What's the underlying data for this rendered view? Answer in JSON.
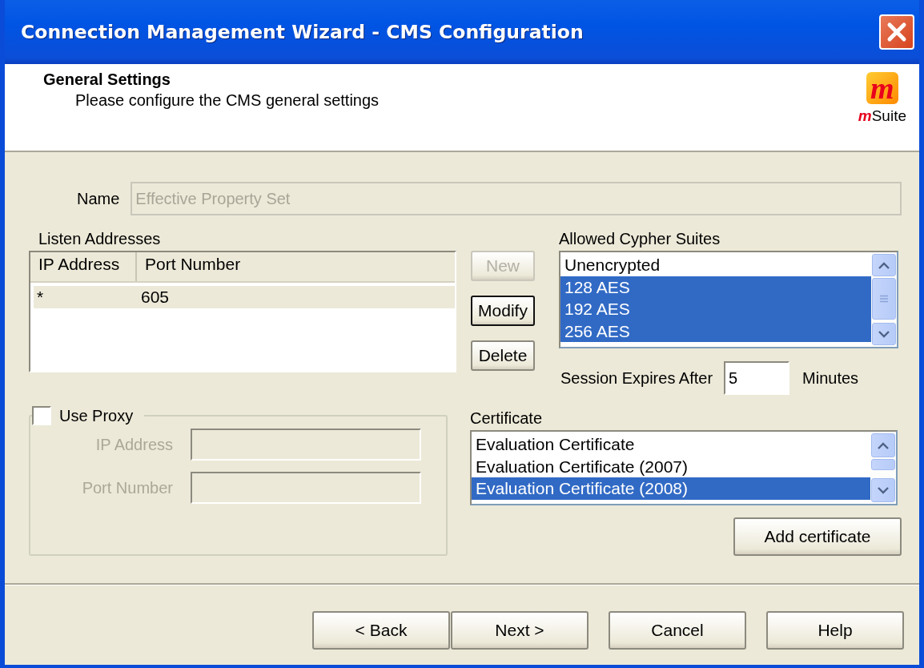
{
  "window": {
    "title": "Connection Management Wizard - CMS Configuration"
  },
  "header": {
    "title": "General Settings",
    "subtitle": "Please configure the CMS general settings",
    "logo": {
      "mark": "m",
      "wordmark_prefix": "m",
      "wordmark": "Suite"
    }
  },
  "name_field": {
    "label": "Name",
    "value": "Effective Property Set",
    "disabled": true
  },
  "listen_addresses": {
    "label": "Listen Addresses",
    "columns": [
      "IP Address",
      "Port Number"
    ],
    "rows": [
      {
        "cells": [
          "*",
          "605"
        ],
        "selected": true
      }
    ]
  },
  "address_buttons": [
    {
      "label": "New",
      "disabled": true,
      "focused": false
    },
    {
      "label": "Modify",
      "disabled": false,
      "focused": true
    },
    {
      "label": "Delete",
      "disabled": false,
      "focused": false
    }
  ],
  "cypher_suites": {
    "label": "Allowed Cypher Suites",
    "items": [
      {
        "label": "Unencrypted",
        "selected": false
      },
      {
        "label": "128 AES",
        "selected": true
      },
      {
        "label": "192 AES",
        "selected": true
      },
      {
        "label": "256 AES",
        "selected": true
      }
    ]
  },
  "session": {
    "label": "Session Expires After",
    "value": "5",
    "unit": "Minutes"
  },
  "proxy": {
    "label": "Use Proxy",
    "checked": false,
    "disabled": true,
    "fields": [
      {
        "label": "IP Address"
      },
      {
        "label": "Port Number"
      }
    ]
  },
  "certificate": {
    "label": "Certificate",
    "items": [
      {
        "label": "Evaluation Certificate",
        "selected": false
      },
      {
        "label": "Evaluation Certificate (2007)",
        "selected": false
      },
      {
        "label": "Evaluation Certificate (2008)",
        "selected": true
      }
    ],
    "button": "Add certificate"
  },
  "footer_buttons": [
    "< Back",
    "Next >",
    "Cancel",
    "Help"
  ]
}
